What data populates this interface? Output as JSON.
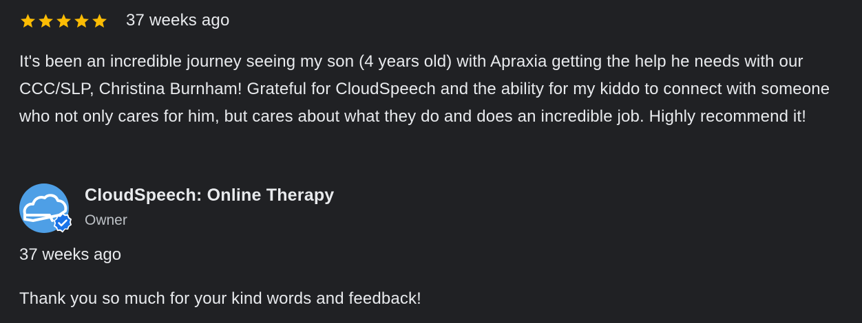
{
  "review": {
    "rating": 5,
    "rating_max": 5,
    "date": "37 weeks ago",
    "text": "It's been an incredible journey seeing my son (4 years old) with Apraxia getting the help he needs with our CCC/SLP, Christina Burnham! Grateful for CloudSpeech and the ability for my kiddo to connect with someone who not only cares for him, but cares about what they do and does an incredible job. Highly recommend it!"
  },
  "owner_reply": {
    "name": "CloudSpeech: Online Therapy",
    "role": "Owner",
    "date": "37 weeks ago",
    "text": "Thank you so much for your kind words and feedback!",
    "avatar_icon": "cloud-logo-icon",
    "badge_icon": "verified-check-icon"
  },
  "colors": {
    "background": "#202124",
    "text": "#e8eaed",
    "secondary_text": "#bdc1c6",
    "star": "#fbbc04",
    "avatar": "#4e9fe6",
    "badge": "#1a73e8"
  }
}
